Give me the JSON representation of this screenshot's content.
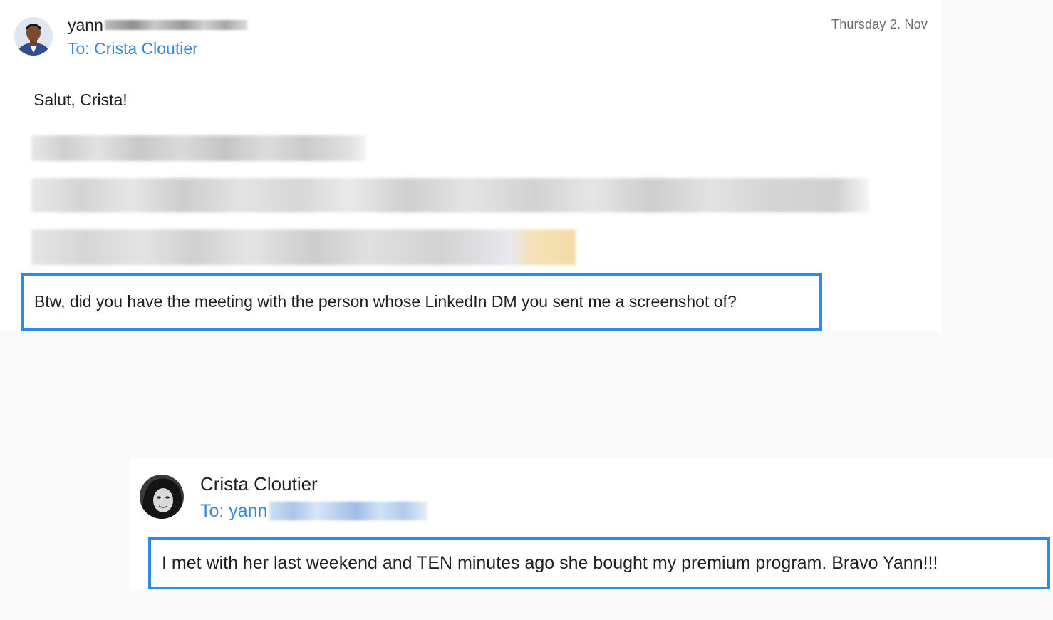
{
  "email1": {
    "sender": "yann",
    "recipient": "To: Crista Cloutier",
    "date": "Thursday 2. Nov",
    "greeting": "Salut, Crista!",
    "highlighted_message": "Btw, did you have the meeting with the person whose LinkedIn DM you sent me a screenshot of?"
  },
  "email2": {
    "sender": "Crista Cloutier",
    "recipient": "To: yann",
    "highlighted_message": "I met with her last weekend and TEN minutes ago she bought my premium program. Bravo Yann!!!"
  },
  "colors": {
    "accent_link": "#3a86d9",
    "highlight_border": "#2c8ae8"
  },
  "icons": {
    "sender1_avatar": "man-portrait-avatar",
    "sender2_avatar": "woman-portrait-avatar"
  }
}
